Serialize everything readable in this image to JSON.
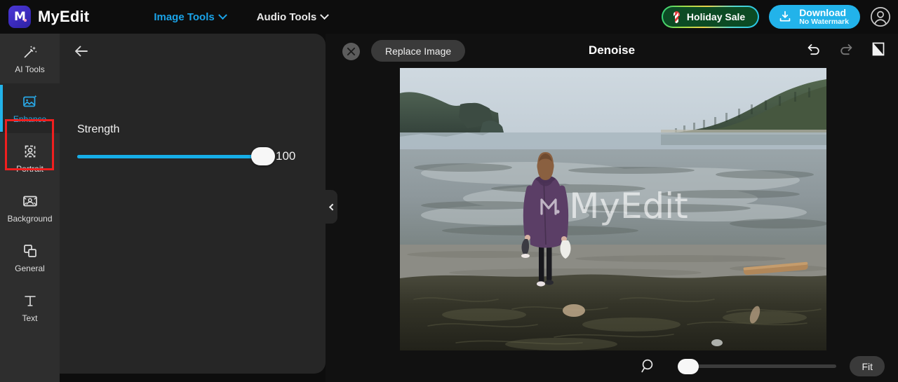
{
  "header": {
    "brand": "MyEdit",
    "logo_icon": "myedit-logo-icon",
    "nav": [
      {
        "label": "Image Tools",
        "icon": "chevron-down-icon",
        "active": true
      },
      {
        "label": "Audio Tools",
        "icon": "chevron-down-icon",
        "active": false
      }
    ],
    "sale_button": {
      "label": "Holiday Sale",
      "icon": "candy-cane-icon",
      "border_colors": "#27d07a,#e8d24a,#22c3e8",
      "fill": "#0c4b24"
    },
    "download_button": {
      "label": "Download",
      "sublabel": "No Watermark",
      "icon": "download-icon",
      "color": "#22b3ea"
    },
    "account_icon": "user-avatar-icon"
  },
  "sidebar": {
    "items": [
      {
        "label": "AI Tools",
        "icon": "magic-wand-icon",
        "selected": false
      },
      {
        "label": "Enhance",
        "icon": "image-sparkle-icon",
        "selected": true
      },
      {
        "label": "Portrait",
        "icon": "portrait-sparkle-icon",
        "selected": false
      },
      {
        "label": "Background",
        "icon": "background-image-icon",
        "selected": false
      },
      {
        "label": "General",
        "icon": "layers-icon",
        "selected": false
      },
      {
        "label": "Text",
        "icon": "text-icon",
        "selected": false
      }
    ],
    "accent_color": "#22b3ea",
    "annotation_color": "#f01f1f"
  },
  "panel": {
    "back_icon": "back-arrow-icon",
    "collapse_icon": "chevron-left-icon",
    "strength": {
      "label": "Strength",
      "value": "100",
      "percent": 100,
      "fill_color": "#16aee8"
    }
  },
  "canvas": {
    "close_icon": "close-icon",
    "replace_button": "Replace Image",
    "title": "Denoise",
    "tools": [
      {
        "name": "undo-icon",
        "state": "enabled"
      },
      {
        "name": "redo-icon",
        "state": "disabled"
      },
      {
        "name": "compare-cursor-icon",
        "state": "enabled"
      }
    ],
    "watermark": {
      "text": "MyEdit",
      "icon": "myedit-watermark-icon"
    },
    "zoom": {
      "magnifier_icon": "magnifier-icon",
      "percent": 5,
      "fit_label": "Fit"
    }
  }
}
